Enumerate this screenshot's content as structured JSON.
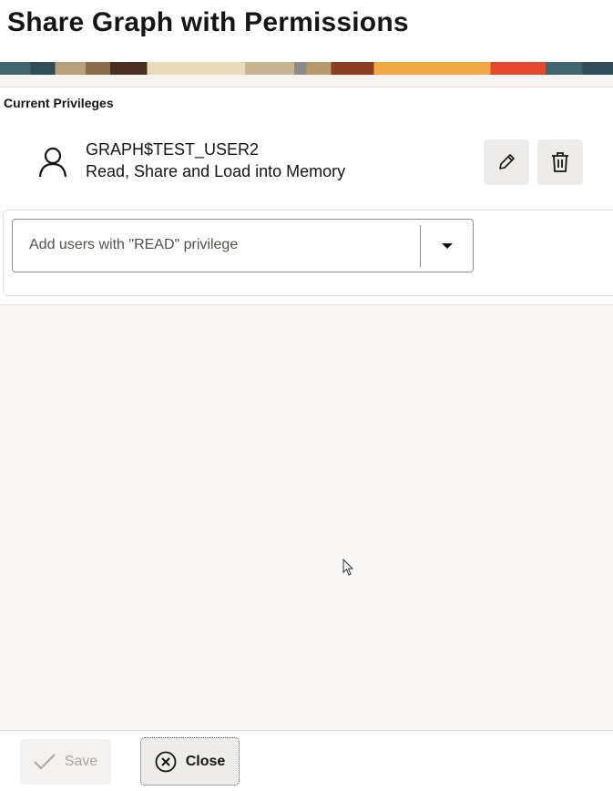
{
  "dialog": {
    "title": "Share Graph with Permissions"
  },
  "privileges": {
    "section_label": "Current Privileges",
    "users": [
      {
        "name": "GRAPH$TEST_USER2",
        "permissions": "Read, Share and Load into Memory",
        "icon": "user-icon"
      }
    ],
    "edit_icon": "pencil-icon",
    "delete_icon": "trash-icon"
  },
  "add_users": {
    "placeholder": "Add users with \"READ\" privilege"
  },
  "footer": {
    "save_label": "Save",
    "close_label": "Close"
  }
}
